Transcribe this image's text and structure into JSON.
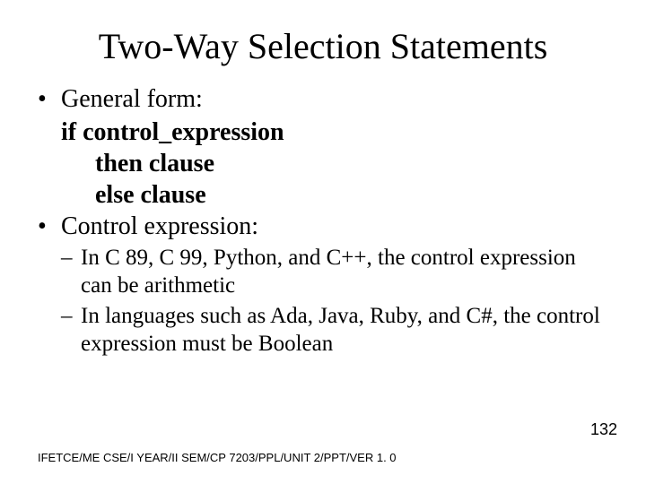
{
  "title": "Two-Way Selection Statements",
  "b1": {
    "label": "General form:"
  },
  "form": {
    "l1": "if control_expression",
    "l2": "then clause",
    "l3": "else clause"
  },
  "b2": {
    "label": "Control expression:"
  },
  "sub": {
    "s1": "In C 89, C 99, Python, and C++, the control expression can be arithmetic",
    "s2": "In languages such as Ada, Java, Ruby, and C#, the control expression must be Boolean"
  },
  "footer": "IFETCE/ME CSE/I YEAR/II SEM/CP 7203/PPL/UNIT 2/PPT/VER 1. 0",
  "page": "132",
  "marks": {
    "bullet": "•",
    "dash": "–"
  }
}
